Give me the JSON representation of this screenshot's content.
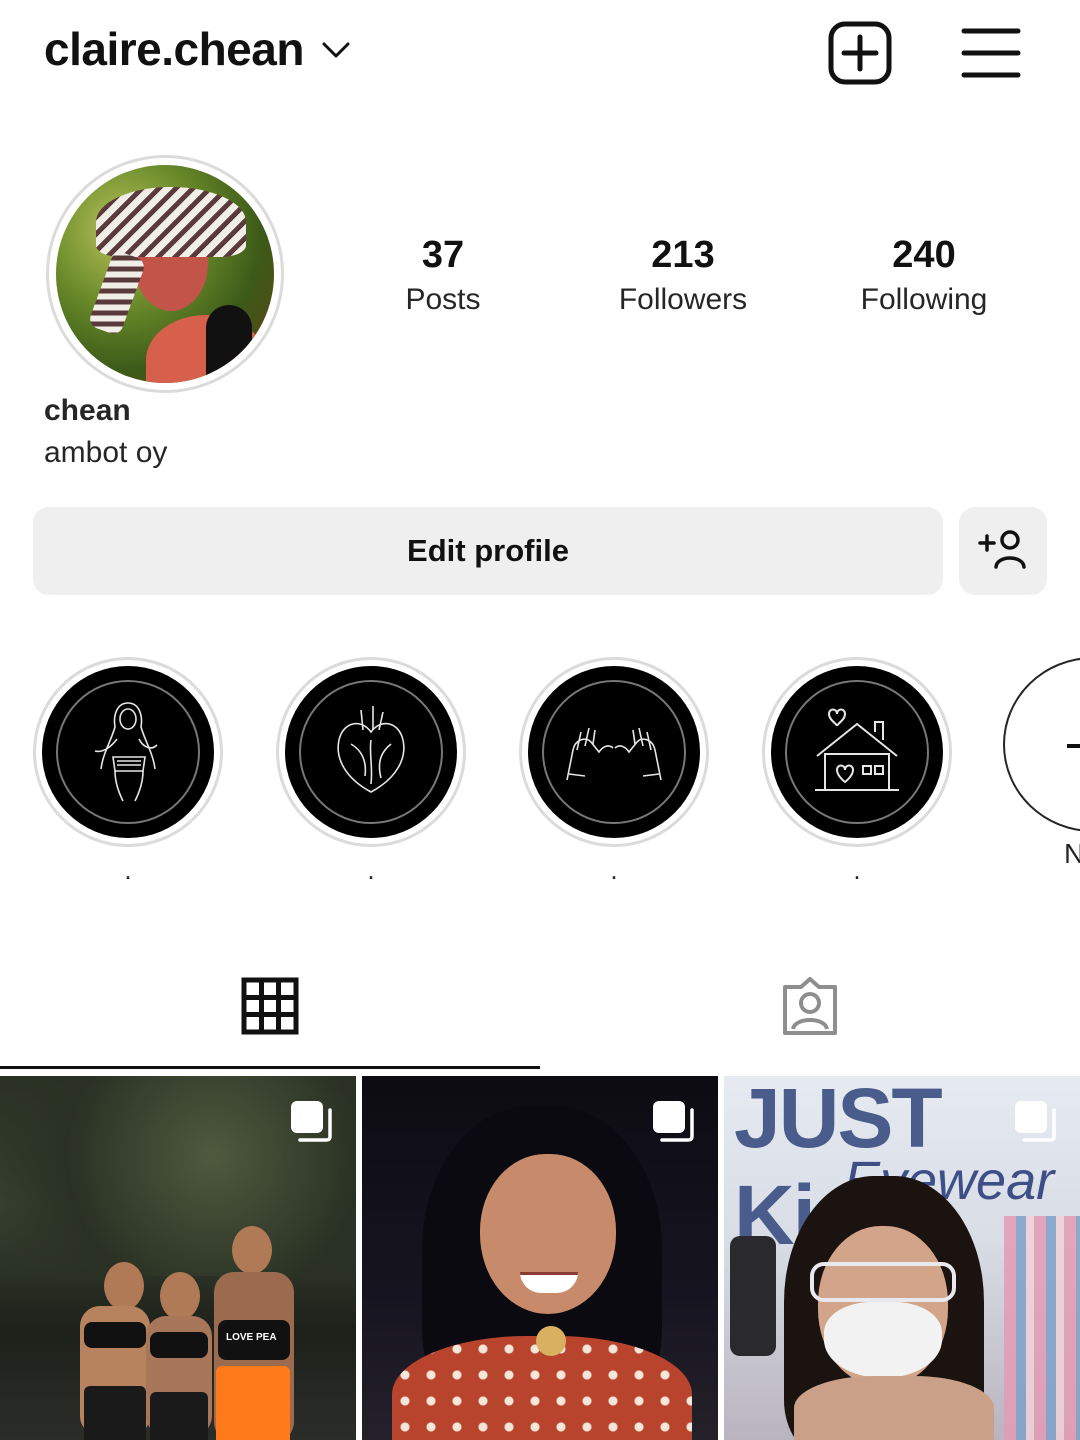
{
  "header": {
    "username": "claire.chean",
    "icons": {
      "dropdown": "chevron-down-icon",
      "new_post": "plus-square-icon",
      "menu": "hamburger-menu-icon"
    }
  },
  "profile": {
    "avatar_alt": "profile-photo",
    "stats": [
      {
        "value": "37",
        "label": "Posts"
      },
      {
        "value": "213",
        "label": "Followers"
      },
      {
        "value": "240",
        "label": "Following"
      }
    ],
    "display_name": "chean",
    "bio": "ambot oy"
  },
  "actions": {
    "edit_profile_label": "Edit profile",
    "discover_people_icon": "add-person-icon"
  },
  "highlights": {
    "items": [
      {
        "label": ".",
        "icon": "woman-sketch-icon"
      },
      {
        "label": ".",
        "icon": "anatomical-heart-icon"
      },
      {
        "label": ".",
        "icon": "pinky-promise-icon"
      },
      {
        "label": ".",
        "icon": "house-heart-icon"
      }
    ],
    "new_label": "N",
    "new_icon": "plus-icon"
  },
  "tabs": [
    {
      "name": "grid",
      "icon": "grid-icon",
      "active": true
    },
    {
      "name": "tagged",
      "icon": "tagged-person-icon",
      "active": false
    }
  ],
  "posts": [
    {
      "type": "carousel",
      "icon": "multiple-posts-icon",
      "caption_text": "LOVE PEA"
    },
    {
      "type": "carousel",
      "icon": "multiple-posts-icon"
    },
    {
      "type": "carousel",
      "icon": "multiple-posts-icon",
      "sign_text": "JUST Kid",
      "sign_text2": "Eyewear"
    }
  ],
  "colors": {
    "button_bg": "#efefef",
    "text": "#111111",
    "ring": "#dbdbdb",
    "highlight_bg": "#000000"
  }
}
